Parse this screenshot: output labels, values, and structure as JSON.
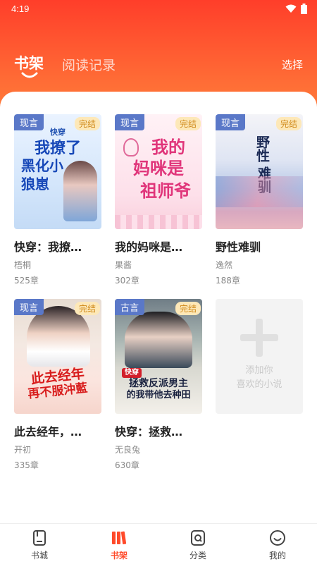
{
  "status_bar": {
    "time": "4:19"
  },
  "header": {
    "tab_active": "书架",
    "tab_inactive": "阅读记录",
    "select_label": "选择"
  },
  "books": [
    {
      "genre": "现言",
      "status": "完结",
      "cover_tag": "快穿",
      "cover_lines": [
        "我撩了",
        "黑化小",
        "狼崽"
      ],
      "title": "快穿：我撩…",
      "author": "梧桐",
      "chapters": "525章"
    },
    {
      "genre": "现言",
      "status": "完结",
      "cover_lines": [
        "我的",
        "妈咪是",
        "祖师爷"
      ],
      "title": "我的妈咪是…",
      "author": "果酱",
      "chapters": "302章"
    },
    {
      "genre": "现言",
      "status": "完结",
      "cover_lines": [
        "野性",
        "难驯"
      ],
      "title": "野性难驯",
      "author": "逸然",
      "chapters": "188章"
    },
    {
      "genre": "现言",
      "status": "完结",
      "cover_lines": [
        "此去经年",
        "再不服沖藍"
      ],
      "title": "此去经年，…",
      "author": "开初",
      "chapters": "335章"
    },
    {
      "genre": "古言",
      "status": "完结",
      "cover_tag": "快穿",
      "cover_lines": [
        "拯救反派男主",
        "的我带他去种田"
      ],
      "title": "快穿：拯救…",
      "author": "无良兔",
      "chapters": "630章"
    }
  ],
  "add_card": {
    "line1": "添加你",
    "line2": "喜欢的小说"
  },
  "nav": {
    "items": [
      {
        "label": "书城"
      },
      {
        "label": "书架"
      },
      {
        "label": "分类"
      },
      {
        "label": "我的"
      }
    ]
  },
  "colors": {
    "accent": "#ff4a2a",
    "genre_badge": "#5a78c8",
    "finished_badge": "#fde8b8"
  }
}
